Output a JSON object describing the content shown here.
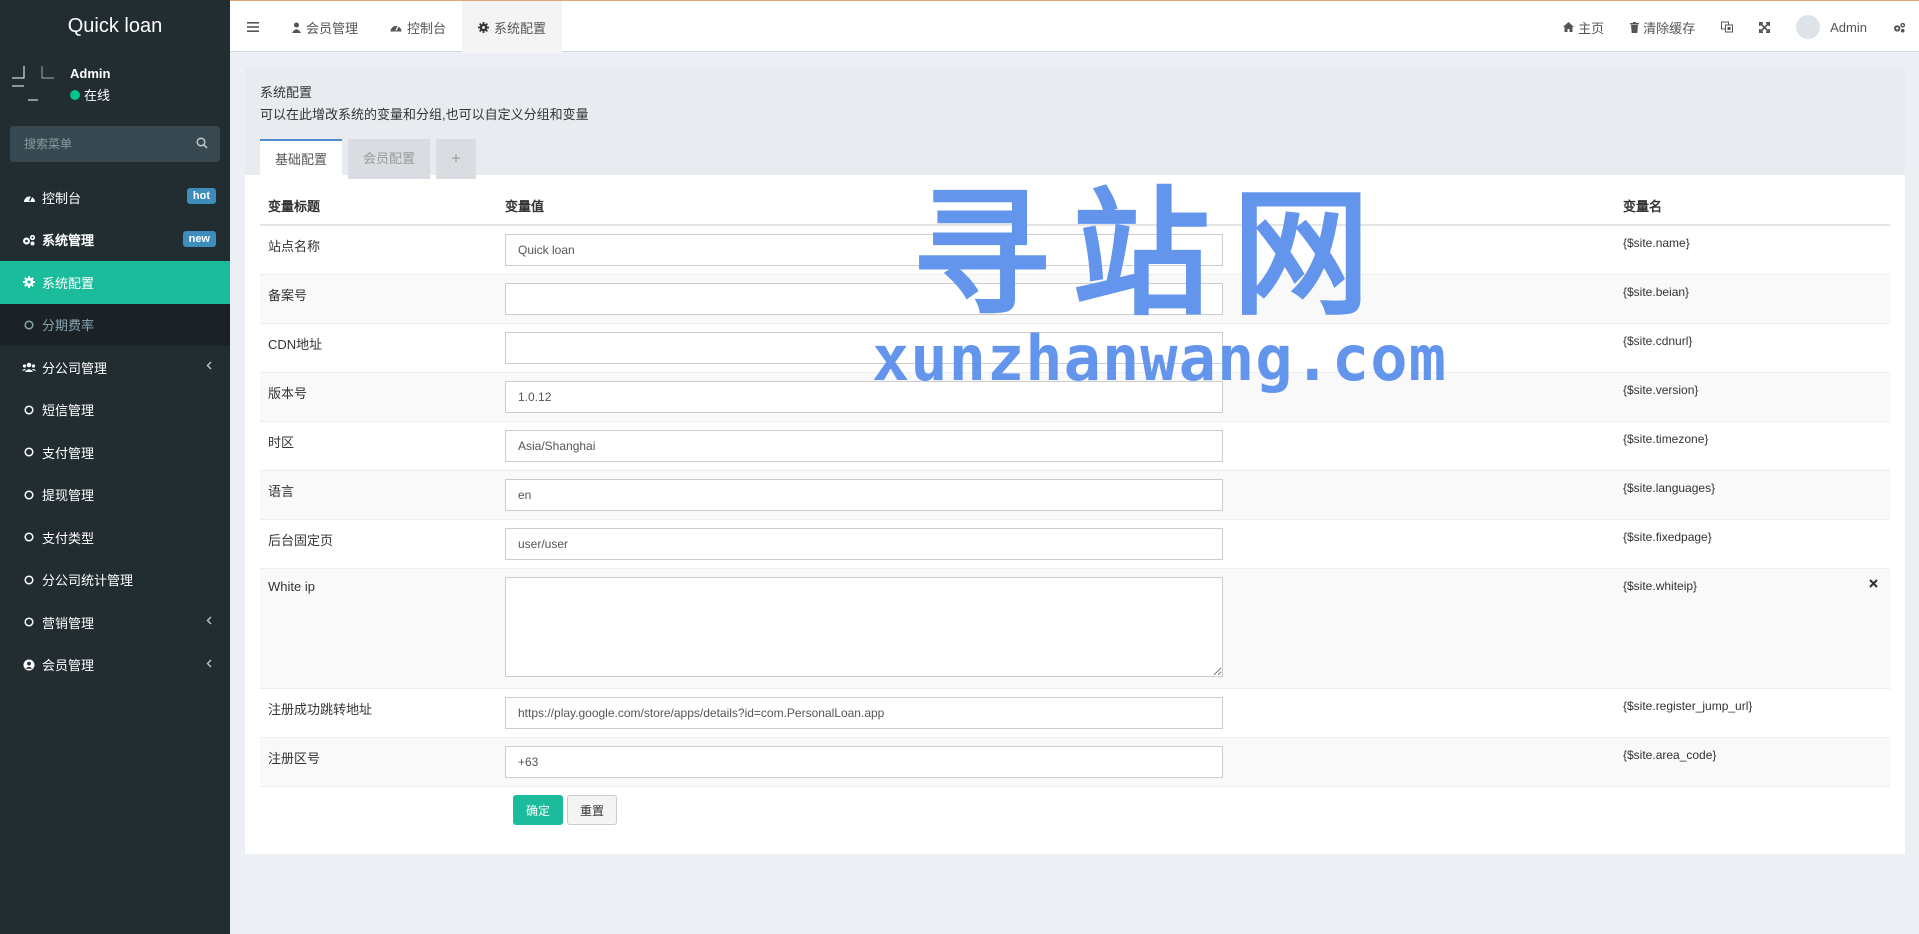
{
  "app": {
    "title": "Quick loan"
  },
  "user": {
    "name": "Admin",
    "status": "在线"
  },
  "search": {
    "placeholder": "搜索菜单"
  },
  "menu": [
    {
      "label": "控制台",
      "icon": "dashboard-icon",
      "badge": "hot"
    },
    {
      "label": "系统管理",
      "icon": "cogs-icon",
      "badge": "new"
    },
    {
      "label": "系统配置",
      "icon": "gear-icon"
    },
    {
      "label": "分期费率",
      "icon": "circle-icon"
    },
    {
      "label": "分公司管理",
      "icon": "users-icon"
    },
    {
      "label": "短信管理",
      "icon": "circle-icon"
    },
    {
      "label": "支付管理",
      "icon": "circle-icon"
    },
    {
      "label": "提现管理",
      "icon": "circle-icon"
    },
    {
      "label": "支付类型",
      "icon": "circle-icon"
    },
    {
      "label": "分公司统计管理",
      "icon": "circle-icon"
    },
    {
      "label": "营销管理",
      "icon": "circle-icon"
    },
    {
      "label": "会员管理",
      "icon": "user-circle-icon"
    }
  ],
  "nav": {
    "tabs": [
      {
        "label": "会员管理",
        "icon": "user-icon"
      },
      {
        "label": "控制台",
        "icon": "dashboard-icon"
      },
      {
        "label": "系统配置",
        "icon": "gear-icon"
      }
    ],
    "home": "主页",
    "clear_cache": "清除缓存",
    "admin": "Admin"
  },
  "page": {
    "title": "系统配置",
    "desc": "可以在此增改系统的变量和分组,也可以自定义分组和变量",
    "tabs": [
      "基础配置",
      "会员配置",
      "+"
    ]
  },
  "table": {
    "headers": [
      "变量标题",
      "变量值",
      "变量名"
    ],
    "rows": [
      {
        "title": "站点名称",
        "value": "Quick loan",
        "name": "{$site.name}"
      },
      {
        "title": "备案号",
        "value": "",
        "name": "{$site.beian}"
      },
      {
        "title": "CDN地址",
        "value": "",
        "name": "{$site.cdnurl}"
      },
      {
        "title": "版本号",
        "value": "1.0.12",
        "name": "{$site.version}"
      },
      {
        "title": "时区",
        "value": "Asia/Shanghai",
        "name": "{$site.timezone}"
      },
      {
        "title": "语言",
        "value": "en",
        "name": "{$site.languages}"
      },
      {
        "title": "后台固定页",
        "value": "user/user",
        "name": "{$site.fixedpage}"
      },
      {
        "title": "White ip",
        "value": "",
        "name": "{$site.whiteip}"
      },
      {
        "title": "注册成功跳转地址",
        "value": "https://play.google.com/store/apps/details?id=com.PersonalLoan.app",
        "name": "{$site.register_jump_url}"
      },
      {
        "title": "注册区号",
        "value": "+63",
        "name": "{$site.area_code}"
      }
    ]
  },
  "buttons": {
    "submit": "确定",
    "reset": "重置"
  },
  "watermark": {
    "cn": "寻站网",
    "en": "xunzhanwang.com"
  },
  "colors": {
    "sidebar": "#222d32",
    "accent": "#1abc9c",
    "badge": "#3c8dbc",
    "watermark": "#6495ed"
  }
}
